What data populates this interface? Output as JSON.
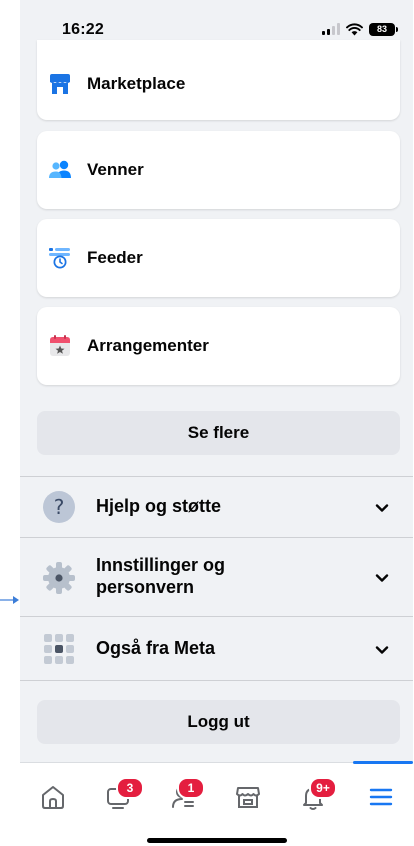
{
  "status_bar": {
    "time": "16:22",
    "battery": "83"
  },
  "shortcuts": [
    {
      "label": "Marketplace",
      "icon": "marketplace-icon"
    },
    {
      "label": "Venner",
      "icon": "friends-icon"
    },
    {
      "label": "Feeder",
      "icon": "feeds-icon"
    },
    {
      "label": "Arrangementer",
      "icon": "events-icon"
    }
  ],
  "see_more_label": "Se flere",
  "sections": [
    {
      "label": "Hjelp og støtte",
      "icon": "help-icon"
    },
    {
      "label": "Innstillinger og personvern",
      "icon": "settings-gear-icon"
    },
    {
      "label": "Også fra Meta",
      "icon": "meta-grid-icon"
    }
  ],
  "logout_label": "Logg ut",
  "tab_bar": {
    "tabs": [
      {
        "name": "home",
        "icon": "home-icon",
        "badge": ""
      },
      {
        "name": "video",
        "icon": "video-icon",
        "badge": "3"
      },
      {
        "name": "friends",
        "icon": "friends-outline-icon",
        "badge": "1"
      },
      {
        "name": "marketplace",
        "icon": "marketplace-outline-icon",
        "badge": ""
      },
      {
        "name": "notifications",
        "icon": "bell-icon",
        "badge": "9+"
      },
      {
        "name": "menu",
        "icon": "menu-icon",
        "badge": "",
        "active": true
      }
    ]
  },
  "colors": {
    "accent": "#1877f2",
    "badge": "#e41e3f",
    "background": "#f0f2f5"
  }
}
